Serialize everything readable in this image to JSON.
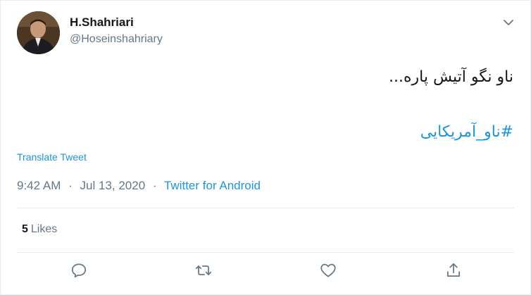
{
  "user": {
    "name": "H.Shahriari",
    "handle": "@Hoseinshahriary"
  },
  "tweet": {
    "text": "ناو نگو آتیش پاره...",
    "hashtag": "#ناو_آمریکایی",
    "translate_label": "Translate Tweet",
    "time": "9:42 AM",
    "date": "Jul 13, 2020",
    "source": "Twitter for Android",
    "separator": "·"
  },
  "stats": {
    "likes_count": "5",
    "likes_label": "Likes"
  },
  "icons": {
    "caret": "chevron-down-icon",
    "reply": "reply-icon",
    "retweet": "retweet-icon",
    "like": "heart-icon",
    "share": "share-icon"
  },
  "colors": {
    "link": "#1b95e0",
    "secondary": "#657786",
    "primary_text": "#14171a",
    "border": "#e6ecf0"
  }
}
